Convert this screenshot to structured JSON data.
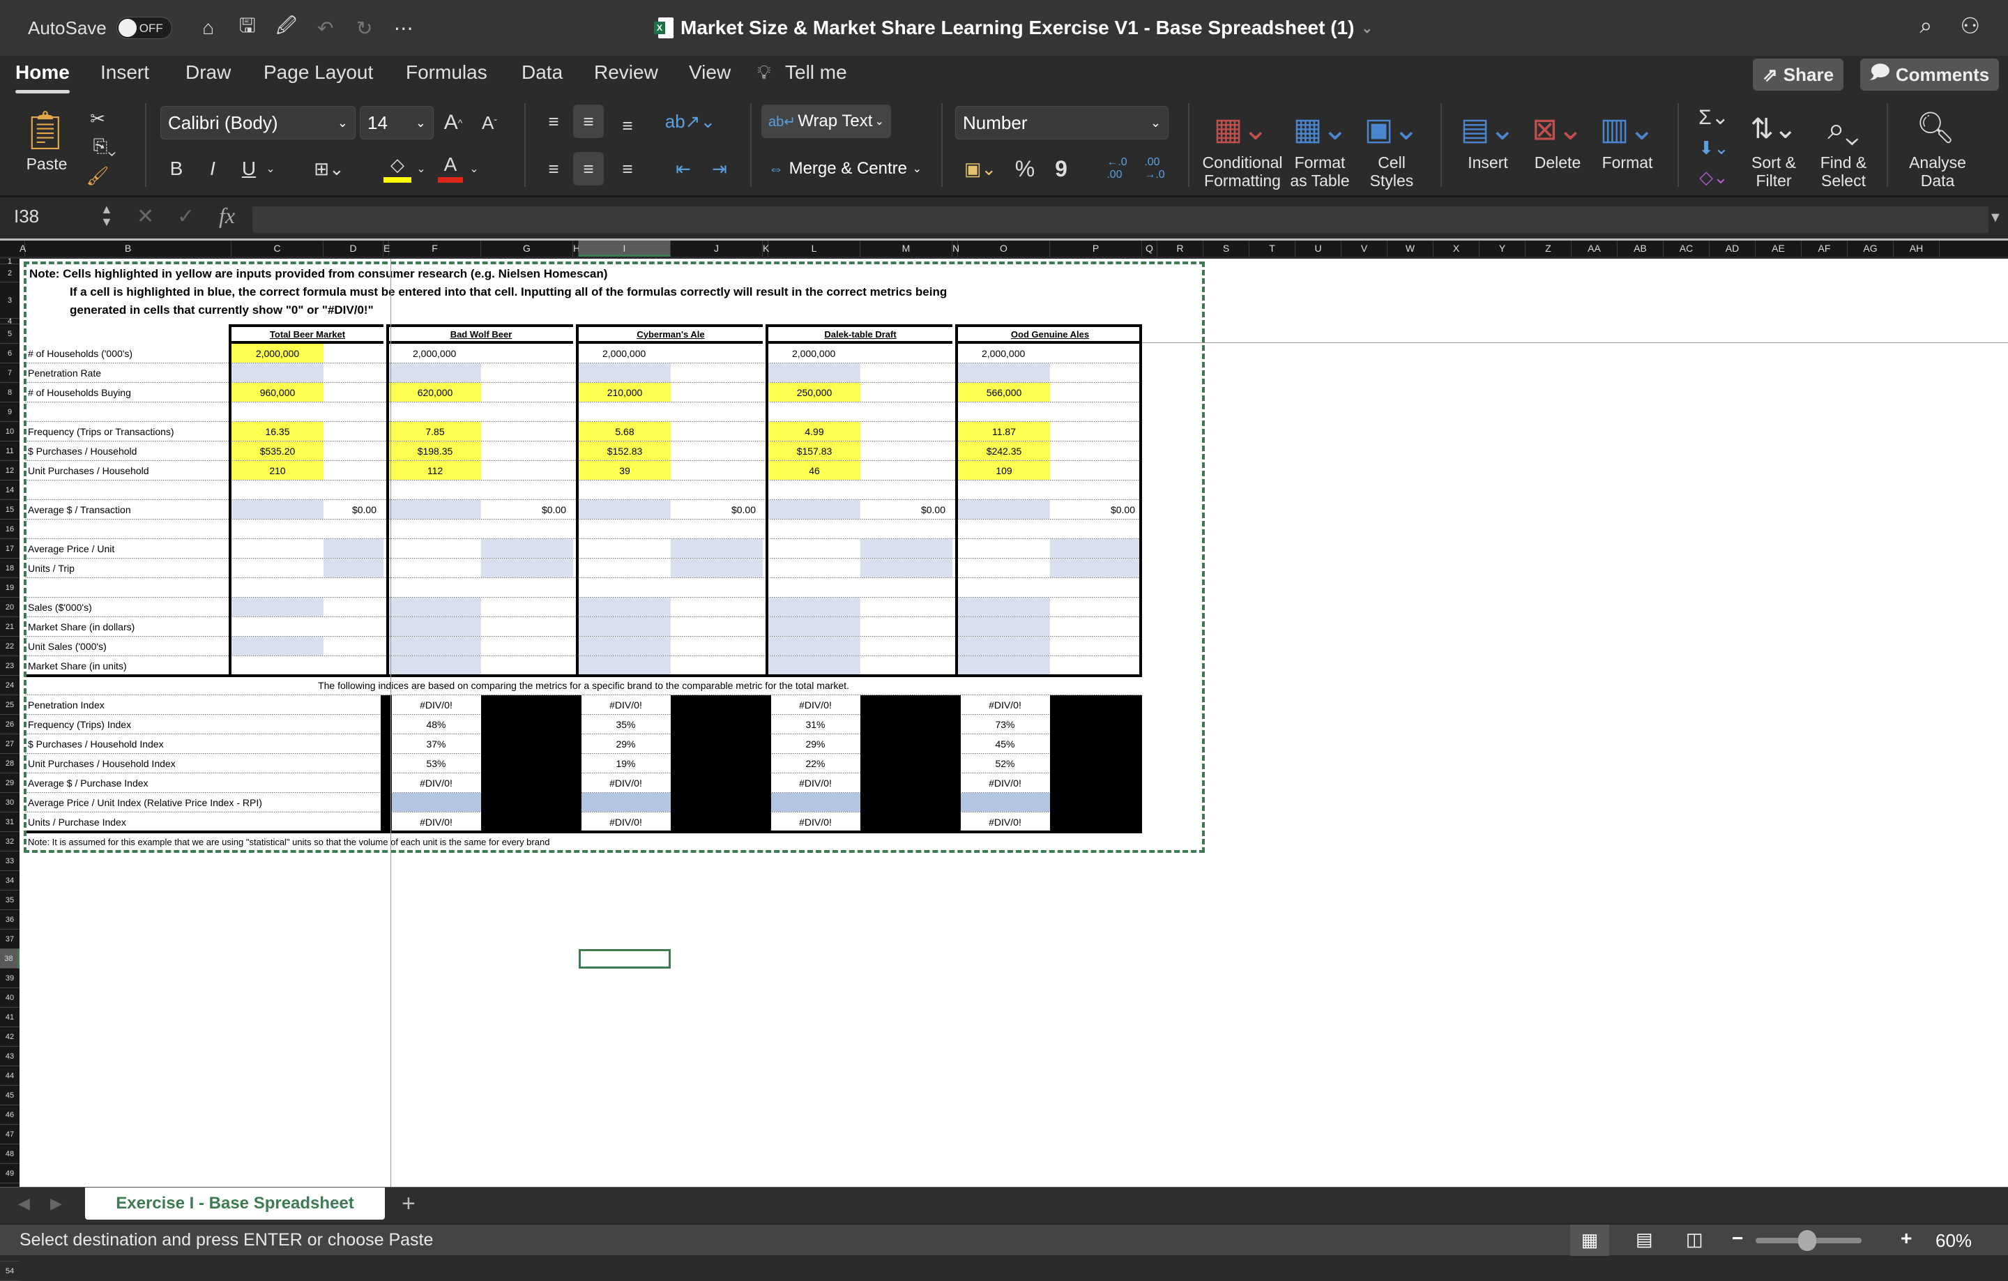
{
  "titlebar": {
    "autosave_label": "AutoSave",
    "autosave_state": "OFF",
    "title": "Market Size & Market Share Learning Exercise V1 - Base Spreadsheet (1)",
    "quick_access": [
      "home-icon",
      "save-icon",
      "save-as-icon",
      "undo-icon",
      "redo-icon",
      "more-icon"
    ]
  },
  "menu_tabs": [
    "Home",
    "Insert",
    "Draw",
    "Page Layout",
    "Formulas",
    "Data",
    "Review",
    "View",
    "Tell me"
  ],
  "active_tab": "Home",
  "share_label": "Share",
  "comments_label": "Comments",
  "ribbon": {
    "paste_label": "Paste",
    "font_name": "Calibri (Body)",
    "font_size": "14",
    "bold": "B",
    "italic": "I",
    "underline": "U",
    "wrap_text": "Wrap Text",
    "merge_centre": "Merge & Centre",
    "number_format": "Number",
    "percent": "%",
    "comma": "9",
    "conditional_formatting": [
      "Conditional",
      "Formatting"
    ],
    "format_as_table": [
      "Format",
      "as Table"
    ],
    "cell_styles": [
      "Cell",
      "Styles"
    ],
    "insert": "Insert",
    "delete": "Delete",
    "format": "Format",
    "sort_filter": [
      "Sort &",
      "Filter"
    ],
    "find_select": [
      "Find &",
      "Select"
    ],
    "analyse_data": [
      "Analyse",
      "Data"
    ],
    "colors": {
      "highlight": "#ffff00",
      "font": "#e0251b"
    }
  },
  "formula_bar": {
    "name_box": "I38",
    "fx": "fx",
    "value": ""
  },
  "columns": [
    "A",
    "B",
    "C",
    "D",
    "E",
    "F",
    "G",
    "H",
    "I",
    "J",
    "K",
    "L",
    "M",
    "N",
    "O",
    "P",
    "Q",
    "R",
    "S",
    "T",
    "U",
    "V",
    "W",
    "X",
    "Y",
    "Z",
    "AA",
    "AB",
    "AC",
    "AD",
    "AE",
    "AF",
    "AG",
    "AH"
  ],
  "selected_column": "I",
  "selected_row": "38",
  "notes": {
    "line1": "Note:  Cells highlighted in yellow are inputs provided from consumer research (e.g. Nielsen Homescan)",
    "line2": "If a cell is highlighted in blue, the correct formula must be entered into that cell.  Inputting all of the formulas correctly will result in the correct metrics being",
    "line3": "generated in cells that currently show \"0\" or \"#DIV/0!\"",
    "indices_header": "The following indices are based on comparing the metrics for a specific brand to the comparable metric for the total market.",
    "footer": "Note:  It is assumed for this example that we are using \"statistical\" units so that the volume of each unit is the same for every brand"
  },
  "brands": [
    "Total Beer Market",
    "Bad Wolf Beer",
    "Cyberman's Ale",
    "Dalek-table Draft",
    "Ood Genuine Ales"
  ],
  "metric_rows": [
    {
      "row": "6",
      "label": "# of Households ('000's)",
      "values": [
        "2,000,000",
        "2,000,000",
        "2,000,000",
        "2,000,000",
        "2,000,000"
      ]
    },
    {
      "row": "7",
      "label": "Penetration Rate",
      "values": [
        "",
        "",
        "",
        "",
        ""
      ]
    },
    {
      "row": "8",
      "label": "# of Households Buying",
      "values": [
        "960,000",
        "620,000",
        "210,000",
        "250,000",
        "566,000"
      ]
    },
    {
      "row": "9",
      "label": "",
      "values": [
        "",
        "",
        "",
        "",
        ""
      ]
    },
    {
      "row": "10",
      "label": "Frequency (Trips or Transactions)",
      "values": [
        "16.35",
        "7.85",
        "5.68",
        "4.99",
        "11.87"
      ]
    },
    {
      "row": "11",
      "label": "$ Purchases / Household",
      "values": [
        "$535.20",
        "$198.35",
        "$152.83",
        "$157.83",
        "$242.35"
      ]
    },
    {
      "row": "12",
      "label": "Unit Purchases / Household",
      "values": [
        "210",
        "112",
        "39",
        "46",
        "109"
      ]
    },
    {
      "row": "14",
      "label": "",
      "values": [
        "",
        "",
        "",
        "",
        ""
      ]
    },
    {
      "row": "15",
      "label": "Average $ / Transaction",
      "values": [
        "",
        "",
        "",
        "",
        ""
      ],
      "secondary": [
        "$0.00",
        "$0.00",
        "$0.00",
        "$0.00",
        "$0.00"
      ]
    },
    {
      "row": "16",
      "label": "",
      "values": [
        "",
        "",
        "",
        "",
        ""
      ]
    },
    {
      "row": "17",
      "label": "Average Price / Unit",
      "values": [
        "",
        "",
        "",
        "",
        ""
      ]
    },
    {
      "row": "18",
      "label": "Units / Trip",
      "values": [
        "",
        "",
        "",
        "",
        ""
      ]
    },
    {
      "row": "19",
      "label": "",
      "values": [
        "",
        "",
        "",
        "",
        ""
      ]
    },
    {
      "row": "20",
      "label": "Sales ($'000's)",
      "values": [
        "",
        "",
        "",
        "",
        ""
      ]
    },
    {
      "row": "21",
      "label": "Market Share (in dollars)",
      "values": [
        "",
        "",
        "",
        "",
        ""
      ]
    },
    {
      "row": "22",
      "label": "Unit Sales ('000's)",
      "values": [
        "",
        "",
        "",
        "",
        ""
      ]
    },
    {
      "row": "23",
      "label": "Market Share (in units)",
      "values": [
        "",
        "",
        "",
        "",
        ""
      ]
    }
  ],
  "index_rows": [
    {
      "row": "25",
      "label": "Penetration Index",
      "values": [
        "#DIV/0!",
        "#DIV/0!",
        "#DIV/0!",
        "#DIV/0!"
      ]
    },
    {
      "row": "26",
      "label": "Frequency (Trips) Index",
      "values": [
        "48%",
        "35%",
        "31%",
        "73%"
      ]
    },
    {
      "row": "27",
      "label": "$ Purchases / Household Index",
      "values": [
        "37%",
        "29%",
        "29%",
        "45%"
      ]
    },
    {
      "row": "28",
      "label": "Unit Purchases / Household Index",
      "values": [
        "53%",
        "19%",
        "22%",
        "52%"
      ]
    },
    {
      "row": "29",
      "label": "Average $ / Purchase Index",
      "values": [
        "#DIV/0!",
        "#DIV/0!",
        "#DIV/0!",
        "#DIV/0!"
      ]
    },
    {
      "row": "30",
      "label": "Average Price / Unit Index (Relative Price Index - RPI)",
      "values": [
        "",
        "",
        "",
        ""
      ]
    },
    {
      "row": "31",
      "label": "Units / Purchase Index",
      "values": [
        "#DIV/0!",
        "#DIV/0!",
        "#DIV/0!",
        "#DIV/0!"
      ]
    }
  ],
  "sheet_tab": "Exercise I - Base Spreadsheet",
  "status_text": "Select destination and press ENTER or choose Paste",
  "zoom": {
    "label": "60%",
    "value_percent": 60
  }
}
